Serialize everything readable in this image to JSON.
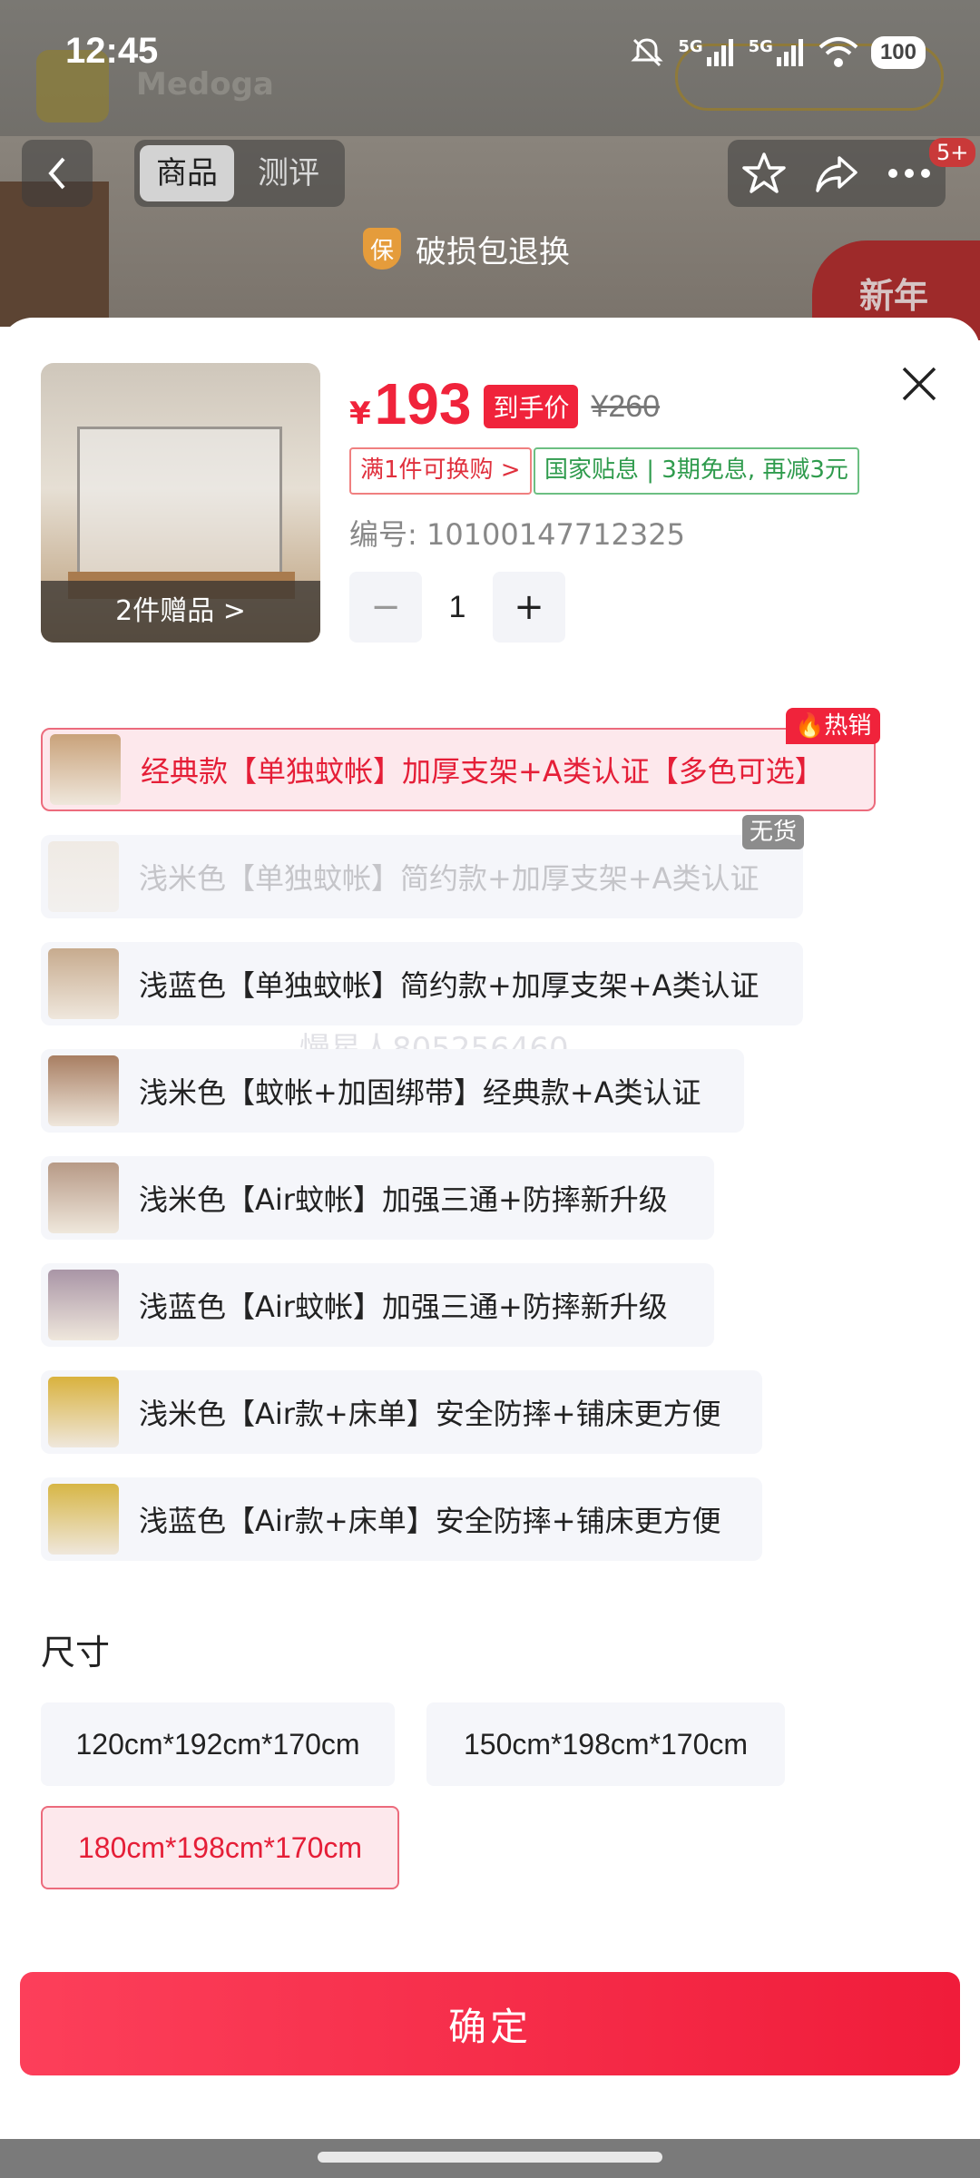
{
  "status": {
    "time": "12:45",
    "net1": "5G",
    "net2": "5G",
    "battery": "100"
  },
  "nav": {
    "tabs": [
      "商品",
      "测评"
    ],
    "badge": "5+"
  },
  "background": {
    "brand": "Medoga",
    "banner": "新年"
  },
  "guarantee": {
    "icon_char": "保",
    "label": "破损包退换"
  },
  "product": {
    "currency": "¥",
    "price": "193",
    "price_tag": "到手价",
    "original_price": "¥260",
    "tag_exchange": "满1件可换购 >",
    "tag_subsidy": "国家贴息 | 3期免息, 再减3元",
    "code": "编号: 10100147712325",
    "gifts": "2件赠品 >",
    "quantity": "1",
    "minus": "−",
    "plus": "+"
  },
  "colors": {
    "hot_badge": "🔥热销",
    "none_badge": "无货",
    "watermark": "慢星人805256460",
    "options": [
      {
        "label": "经典款【单独蚊帐】加厚支架+A类认证【多色可选】",
        "state": "selected",
        "thumb_color": "#c9a27a"
      },
      {
        "label": "浅米色【单独蚊帐】简约款+加厚支架+A类认证",
        "state": "disabled",
        "thumb_color": "#e8d9c4"
      },
      {
        "label": "浅蓝色【单独蚊帐】简约款+加厚支架+A类认证",
        "state": "normal",
        "thumb_color": "#c7ab8e"
      },
      {
        "label": "浅米色【蚊帐+加固绑带】经典款+A类认证",
        "state": "normal",
        "thumb_color": "#a87e62"
      },
      {
        "label": "浅米色【Air蚊帐】加强三通+防摔新升级",
        "state": "normal",
        "thumb_color": "#b79a86"
      },
      {
        "label": "浅蓝色【Air蚊帐】加强三通+防摔新升级",
        "state": "normal",
        "thumb_color": "#a995a6"
      },
      {
        "label": "浅米色【Air款+床单】安全防摔+铺床更方便",
        "state": "normal",
        "thumb_color": "#d9b23e"
      },
      {
        "label": "浅蓝色【Air款+床单】安全防摔+铺床更方便",
        "state": "normal",
        "thumb_color": "#d7b646"
      }
    ]
  },
  "sizes": {
    "title": "尺寸",
    "options": [
      {
        "label": "120cm*192cm*170cm",
        "selected": false
      },
      {
        "label": "150cm*198cm*170cm",
        "selected": false
      },
      {
        "label": "180cm*198cm*170cm",
        "selected": true
      }
    ]
  },
  "confirm_label": "确定"
}
